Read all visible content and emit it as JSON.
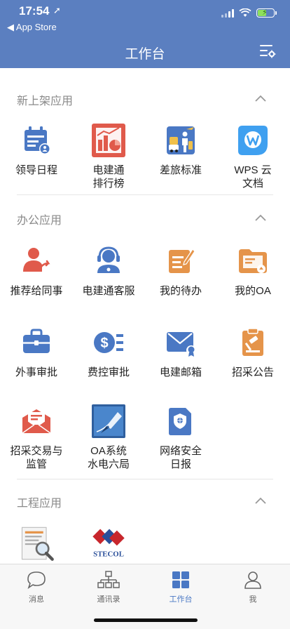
{
  "status": {
    "time": "17:54",
    "back_label": "◀ App Store"
  },
  "header": {
    "title": "工作台"
  },
  "sections": [
    {
      "title": "新上架应用",
      "apps": [
        {
          "label": "领导日程",
          "icon": "calendar-user-icon"
        },
        {
          "label": "电建通\n排行榜",
          "icon": "ranking-chart-icon"
        },
        {
          "label": "差旅标准",
          "icon": "travel-icon"
        },
        {
          "label": "WPS 云\n文档",
          "icon": "wps-cloud-icon"
        }
      ]
    },
    {
      "title": "办公应用",
      "apps": [
        {
          "label": "推荐给同事",
          "icon": "share-user-icon"
        },
        {
          "label": "电建通客服",
          "icon": "headset-icon"
        },
        {
          "label": "我的待办",
          "icon": "todo-icon"
        },
        {
          "label": "我的OA",
          "icon": "folder-icon"
        },
        {
          "label": "外事审批",
          "icon": "briefcase-icon"
        },
        {
          "label": "费控审批",
          "icon": "dollar-list-icon"
        },
        {
          "label": "电建邮箱",
          "icon": "mail-icon"
        },
        {
          "label": "招采公告",
          "icon": "clipboard-hammer-icon"
        },
        {
          "label": "招采交易与\n监管",
          "icon": "mail-open-icon"
        },
        {
          "label": "OA系统\n水电六局",
          "icon": "fountain-pen-icon"
        },
        {
          "label": "网络安全\n日报",
          "icon": "security-doc-icon"
        }
      ]
    },
    {
      "title": "工程应用",
      "apps": [
        {
          "label": "",
          "icon": "document-search-icon"
        },
        {
          "label": "",
          "icon": "stecol-logo-icon",
          "logo_text": "STECOL"
        }
      ]
    }
  ],
  "tabbar": [
    {
      "label": "消息",
      "icon": "chat-bubble-icon",
      "active": false
    },
    {
      "label": "通讯录",
      "icon": "org-chart-icon",
      "active": false
    },
    {
      "label": "工作台",
      "icon": "grid-icon",
      "active": true
    },
    {
      "label": "我",
      "icon": "person-icon",
      "active": false
    }
  ],
  "colors": {
    "header": "#5b7fc0",
    "blue": "#4a78c4",
    "red": "#e05a4b",
    "orange": "#e5944a",
    "active_tab": "#4a78c4"
  }
}
